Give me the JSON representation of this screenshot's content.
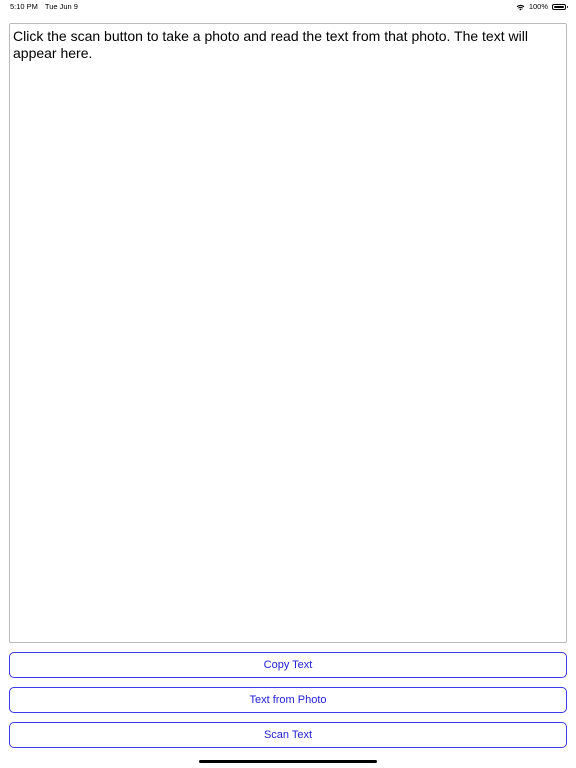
{
  "status_bar": {
    "time": "5:10 PM",
    "date": "Tue Jun 9",
    "battery_percent": "100%",
    "icons": [
      "wifi-icon",
      "battery-icon"
    ]
  },
  "main": {
    "text_content": "Click the scan button to take a photo and read the text from that photo.  The text will appear here."
  },
  "buttons": {
    "copy_label": "Copy Text",
    "photo_label": "Text from Photo",
    "scan_label": "Scan Text"
  },
  "colors": {
    "accent": "#2020d8",
    "border": "#b9b9bd"
  }
}
